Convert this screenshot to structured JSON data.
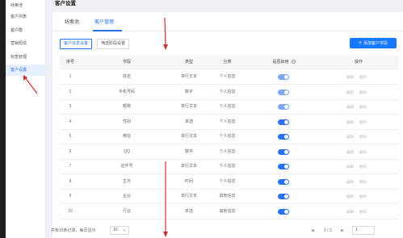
{
  "sidebar": {
    "items": [
      {
        "label": "线索池"
      },
      {
        "label": "客户列表"
      },
      {
        "label": "客户群"
      },
      {
        "label": "营销短信"
      },
      {
        "label": "标签管理"
      },
      {
        "label": "客户设置"
      }
    ],
    "active_index": 5
  },
  "page_title": "客户设置",
  "tabs": [
    {
      "label": "线索池"
    },
    {
      "label": "客户管理"
    }
  ],
  "active_tab": 1,
  "subtabs": [
    {
      "label": "客户信息设置"
    },
    {
      "label": "筛选阶段设置"
    }
  ],
  "add_button": {
    "icon": "plus-icon",
    "label": "添加客户字段"
  },
  "table": {
    "headers": [
      "序号",
      "字段",
      "类型",
      "分类",
      "是否启用",
      "操作"
    ],
    "rows": [
      {
        "no": "1",
        "field": "姓名",
        "type": "单行文本",
        "category": "个人信息",
        "enabled": true,
        "locked": true
      },
      {
        "no": "2",
        "field": "手机号码",
        "type": "数字",
        "category": "个人信息",
        "enabled": true,
        "locked": true
      },
      {
        "no": "3",
        "field": "昵称",
        "type": "单行文本",
        "category": "个人信息",
        "enabled": true,
        "locked": true
      },
      {
        "no": "4",
        "field": "性别",
        "type": "单选",
        "category": "个人信息",
        "enabled": true,
        "locked": false
      },
      {
        "no": "5",
        "field": "微信",
        "type": "单行文本",
        "category": "个人信息",
        "enabled": true,
        "locked": false
      },
      {
        "no": "6",
        "field": "QQ",
        "type": "数字",
        "category": "个人信息",
        "enabled": true,
        "locked": false
      },
      {
        "no": "7",
        "field": "证件号",
        "type": "单行文本",
        "category": "个人信息",
        "enabled": true,
        "locked": false
      },
      {
        "no": "8",
        "field": "生日",
        "type": "时间",
        "category": "个人信息",
        "enabled": true,
        "locked": false
      },
      {
        "no": "9",
        "field": "企业",
        "type": "单行文本",
        "category": "其他信息",
        "enabled": true,
        "locked": false
      },
      {
        "no": "10",
        "field": "行业",
        "type": "单选",
        "category": "其他信息",
        "enabled": true,
        "locked": false
      }
    ],
    "actions": {
      "edit": "编辑",
      "delete": "删除"
    }
  },
  "footer": {
    "summary": "共有15条记录，每页显示",
    "page_size": "10",
    "page_indicator": "1 / 2",
    "current_page": "1"
  },
  "colors": {
    "accent": "#2b71e8",
    "annotation_arrow": "#d32f2f"
  }
}
